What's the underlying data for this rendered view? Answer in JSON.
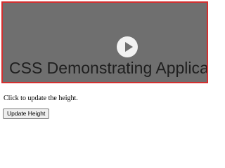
{
  "video": {
    "caption": "CSS Demonstrating Applica",
    "play_icon": "play-icon",
    "border_color": "#d32f2f",
    "background_color": "#6f6f6f"
  },
  "instructions": {
    "text": "Click to update the height."
  },
  "controls": {
    "update_label": "Update Height"
  }
}
